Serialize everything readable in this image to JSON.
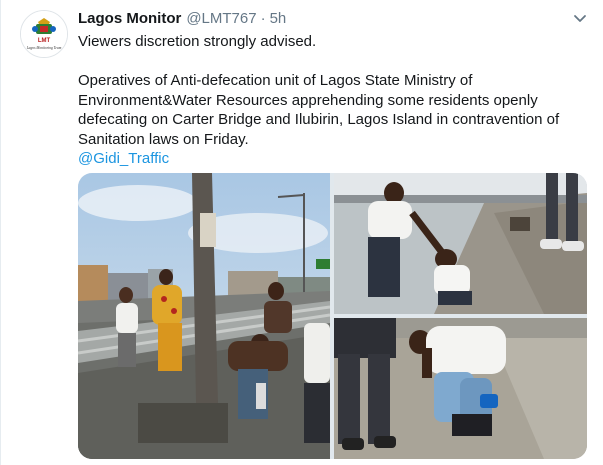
{
  "tweet": {
    "display_name": "Lagos Monitor",
    "handle": "@LMT767",
    "separator": "·",
    "time": "5h",
    "menu_icon": "chevron-down-icon",
    "lines": [
      "Viewers discretion strongly advised.",
      "",
      "Operatives of Anti-defecation unit of Lagos State Ministry of",
      "Environment&Water Resources apprehending some residents openly",
      "defecating on Carter Bridge and Ilubirin, Lagos Island in contravention of",
      "Sanitation laws on Friday."
    ],
    "mention": "@Gidi_Traffic"
  },
  "avatar": {
    "logo_top_text": "LMT",
    "logo_bottom_text": "Lagos Monitoring Team"
  },
  "colors": {
    "link": "#1b95e0",
    "secondary_text": "#657786",
    "primary_text": "#14171a"
  }
}
